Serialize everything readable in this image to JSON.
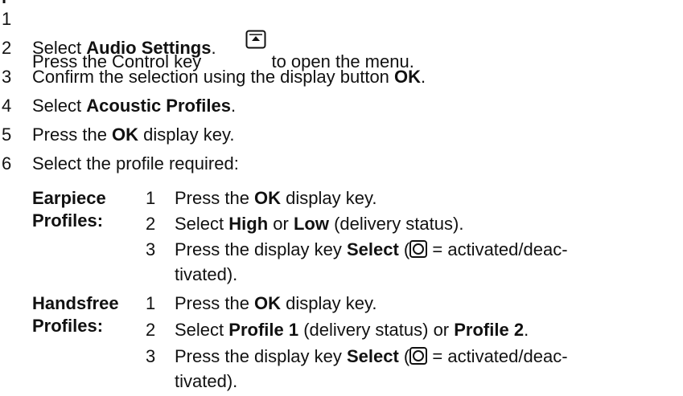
{
  "partial_top_text": "p",
  "steps": [
    {
      "num": "1",
      "before": "Press the Control key",
      "icon": "control-key-icon",
      "after": "to open the menu."
    },
    {
      "num": "2",
      "before": "Select ",
      "bold": "Audio Settings",
      "after": "."
    },
    {
      "num": "3",
      "before": "Confirm the selection using the display button ",
      "bold": "OK",
      "after": "."
    },
    {
      "num": "4",
      "before": "Select ",
      "bold": "Acoustic Profiles",
      "after": "."
    },
    {
      "num": "5",
      "before": "Press the ",
      "bold": "OK",
      "after": " display key."
    },
    {
      "num": "6",
      "text": "Select the profile required:"
    }
  ],
  "earpiece": {
    "label_line1": "Earpiece",
    "label_line2": "Profiles:",
    "s1": {
      "num": "1",
      "before": "Press the ",
      "bold": "OK",
      "after": " display key."
    },
    "s2": {
      "num": "2",
      "before": "Select ",
      "bold1": "High",
      "mid": " or ",
      "bold2": "Low",
      "after": " (delivery status)."
    },
    "s3": {
      "num": "3",
      "before": "Press the display key ",
      "bold": "Select",
      "paren_open": " (",
      "icon": "circle-select-icon",
      "after1": " = activated/deac-",
      "after2": "tivated)."
    }
  },
  "handsfree": {
    "label_line1": "Handsfree",
    "label_line2": "Profiles:",
    "s1": {
      "num": "1",
      "before": "Press the ",
      "bold": "OK",
      "after": " display key."
    },
    "s2": {
      "num": "2",
      "before": "Select ",
      "bold1": "Profile 1",
      "mid": " (delivery status) or ",
      "bold2": "Profile 2",
      "after": "."
    },
    "s3": {
      "num": "3",
      "before": "Press the display key ",
      "bold": "Select",
      "paren_open": " (",
      "icon": "circle-select-icon",
      "after1": " = activated/deac-",
      "after2": "tivated)."
    }
  }
}
